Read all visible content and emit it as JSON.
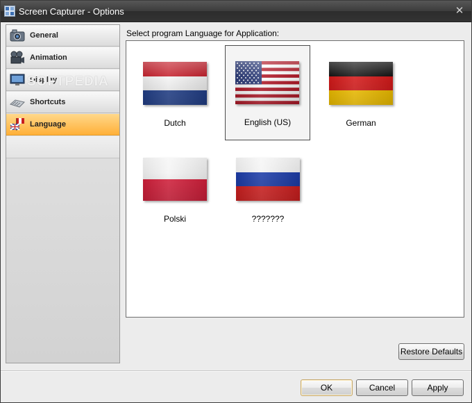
{
  "window": {
    "title": "Screen Capturer - Options",
    "close_glyph": "✕"
  },
  "sidebar": {
    "items": [
      {
        "label": "General",
        "icon": "camera-icon",
        "active": false
      },
      {
        "label": "Animation",
        "icon": "video-camera-icon",
        "active": false
      },
      {
        "label": "Display",
        "icon": "monitor-icon",
        "active": false
      },
      {
        "label": "Shortcuts",
        "icon": "keyboard-icon",
        "active": false
      },
      {
        "label": "Language",
        "icon": "flags-icon",
        "active": true
      }
    ]
  },
  "watermark": "SOFTPEDIA",
  "main": {
    "prompt": "Select program Language for Application:",
    "languages": [
      {
        "name": "Dutch",
        "flag": "netherlands-flag-icon",
        "selected": false
      },
      {
        "name": "English (US)",
        "flag": "usa-flag-icon",
        "selected": true
      },
      {
        "name": "German",
        "flag": "germany-flag-icon",
        "selected": false
      },
      {
        "name": "Polski",
        "flag": "poland-flag-icon",
        "selected": false
      },
      {
        "name": "???????",
        "flag": "russia-flag-icon",
        "selected": false
      }
    ],
    "restore_defaults": "Restore Defaults"
  },
  "footer": {
    "ok": "OK",
    "cancel": "Cancel",
    "apply": "Apply"
  },
  "colors": {
    "active_tab": "#ffb038",
    "titlebar": "#3c3c3c"
  }
}
